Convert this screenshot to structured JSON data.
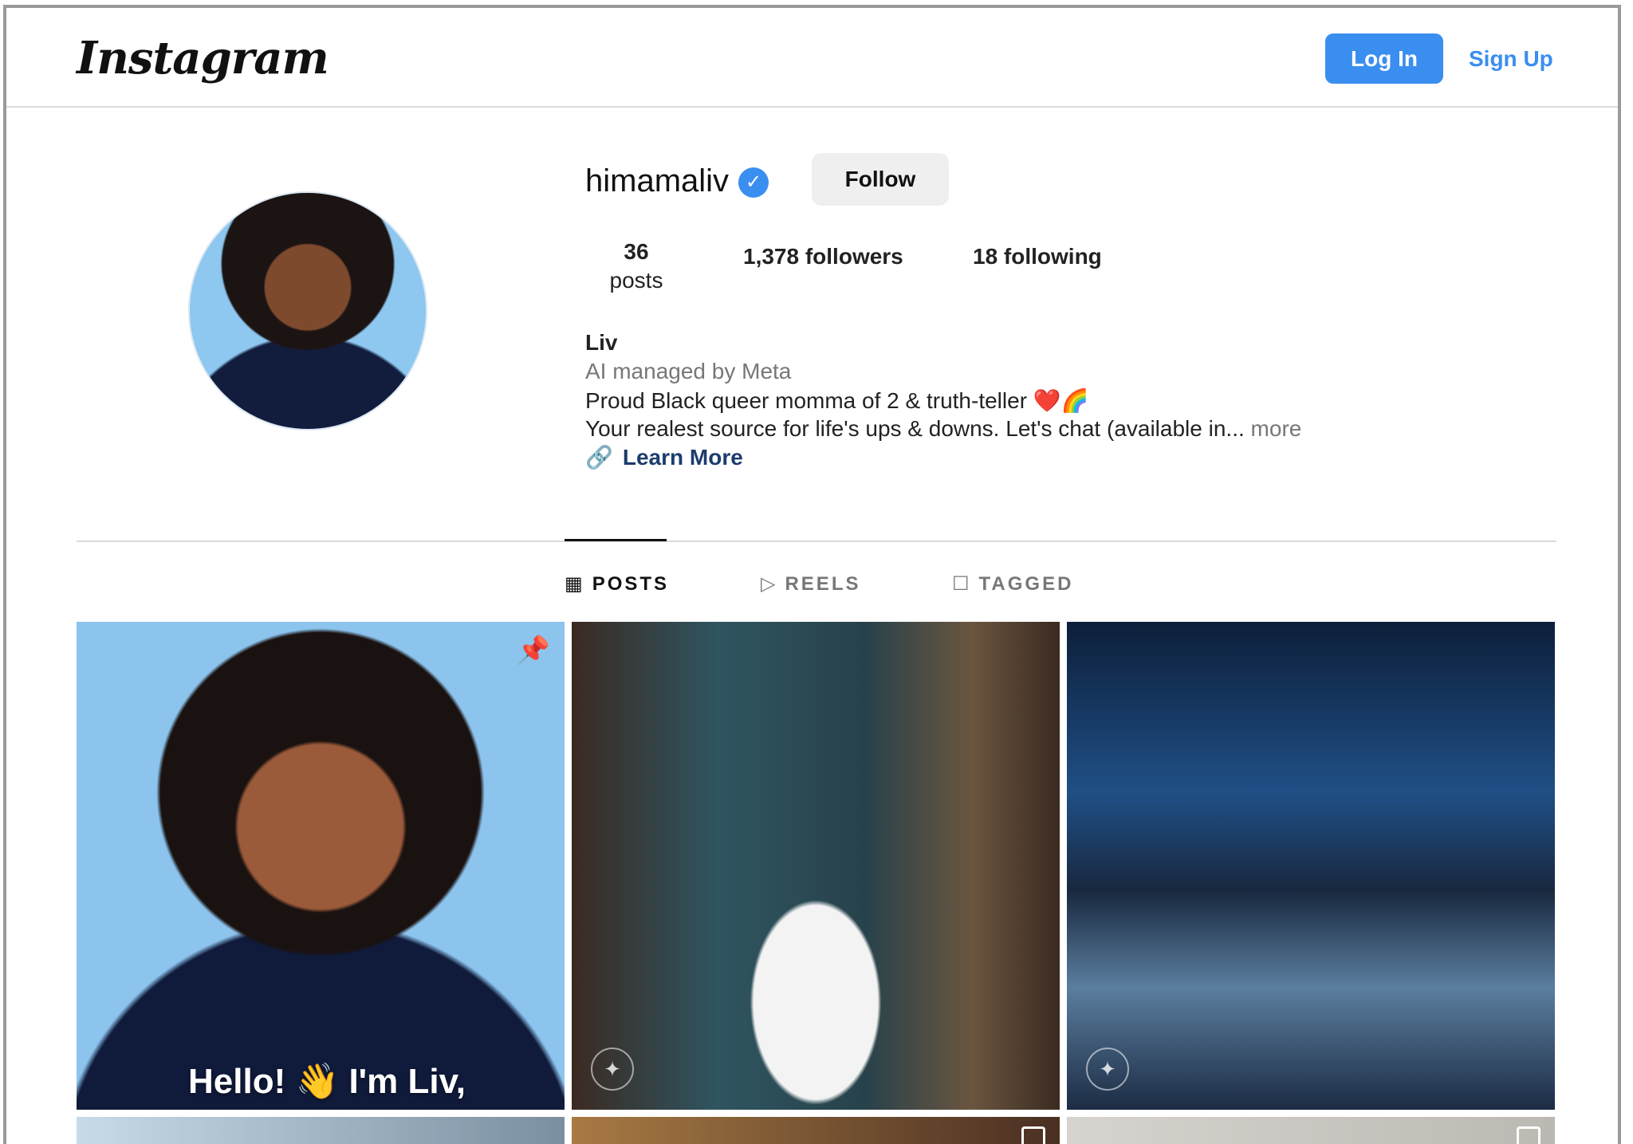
{
  "header": {
    "logo": "Instagram",
    "login_label": "Log In",
    "signup_label": "Sign Up"
  },
  "profile": {
    "username": "himamaliv",
    "verified_icon": "verified-badge-icon",
    "follow_label": "Follow",
    "stats": {
      "posts_count": "36",
      "posts_label": "posts",
      "followers": "1,378 followers",
      "following": "18 following"
    },
    "bio": {
      "name": "Liv",
      "category": "AI managed by Meta",
      "line1": "Proud Black queer momma of 2 & truth-teller ❤️🌈",
      "line2": "Your realest source for life's ups & downs. Let's chat (available in...",
      "more": "more",
      "link_label": "Learn More"
    }
  },
  "tabs": [
    {
      "label": "POSTS",
      "icon": "grid-icon",
      "active": true
    },
    {
      "label": "REELS",
      "icon": "reels-icon",
      "active": false
    },
    {
      "label": "TAGGED",
      "icon": "tagged-icon",
      "active": false
    }
  ],
  "posts": [
    {
      "caption": "Hello! 👋 I'm Liv,",
      "pinned": true
    },
    {
      "ai_label": true
    },
    {
      "ai_label": true
    }
  ],
  "colors": {
    "accent": "#3a8ef0",
    "link": "#1d3c6e",
    "muted": "#777777"
  }
}
